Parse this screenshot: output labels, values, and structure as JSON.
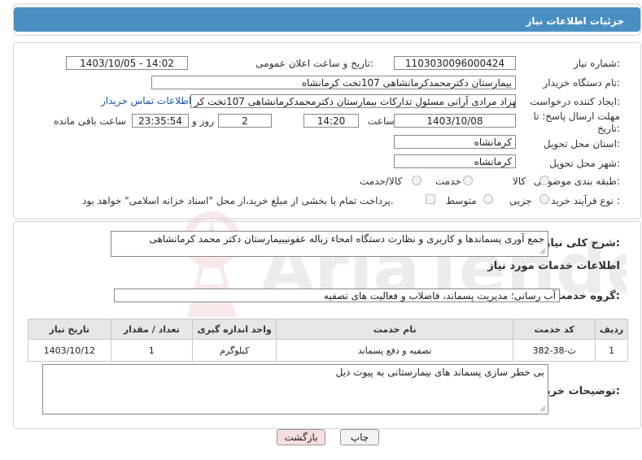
{
  "header": {
    "title": "جزئیات اطلاعات نیاز"
  },
  "form": {
    "need_number_label": "شماره نیاز:",
    "need_number": "1103030096000424",
    "announce_label": "تاریخ و ساعت اعلان عمومی:",
    "announce_value": "1403/10/05 - 14:02",
    "buyer_org_label": "نام دستگاه خریدار:",
    "buyer_org": "بیمارستان دکترمحمدکرمانشاهی 107تخت کرمانشاه",
    "requester_label": "ایجاد کننده درخواست:",
    "requester": "بهزاد مرادی آرانی مسئول تدارکات بیمارستان دکترمحمدکرمانشاهی 107تخت کر",
    "contact_link": "اطلاعات تماس خریدار",
    "deadline_label_1": "مهلت ارسال پاسخ: تا",
    "deadline_label_2": "تاریخ:",
    "deadline_date": "1403/10/08",
    "time_label": "ساعت",
    "deadline_time": "14:20",
    "days_value": "2",
    "days_label": "روز و",
    "remaining_time": "23:35:54",
    "remaining_label": "ساعت باقی مانده",
    "province_label": "استان محل تحویل:",
    "province": "کرمانشاه",
    "city_label": "شهر محل تحویل:",
    "city": "کرمانشاه",
    "category_label": "طبقه بندی موضوعی:",
    "category_options": [
      "کالا",
      "خدمت",
      "کالا/خدمت"
    ],
    "process_label": "نوع فرآیند خرید :",
    "process_options": [
      "جزیی",
      "متوسط"
    ],
    "payment_note": "پرداخت تمام یا بخشی از مبلغ خرید،از محل \"اسناد خزانه اسلامی\" خواهد بود."
  },
  "details": {
    "summary_label": "شرح کلی نیاز:",
    "summary": "جمع آوری پسماندها و کاربری و نظارت دستگاه امحاء زباله عفونیبیمارستان دکتر محمد کرمانشاهی",
    "services_title": "اطلاعات خدمات مورد نیاز",
    "group_label": "گروه خدمت:",
    "group_value": "آب رسانی؛ مدیریت پسماند، فاضلاب و فعالیت های تصفیه",
    "table": {
      "headers": [
        "ردیف",
        "کد خدمت",
        "نام خدمت",
        "واحد اندازه گیری",
        "تعداد / مقدار",
        "تاریخ نیاز"
      ],
      "row": [
        "1",
        "ث-38-382",
        "تصفیه و دفع پسماند",
        "کیلوگرم",
        "1",
        "1403/10/12"
      ]
    },
    "buyer_notes_label": "توضیحات خریدار:",
    "buyer_notes": "بی خطر سازی پسماند های بیمارستانی به پیوت ذیل"
  },
  "buttons": {
    "print": "چاپ",
    "back": "بازگشت"
  },
  "colors": {
    "header_bar": "#4a8fc2",
    "back_button_bg": "#f7dede",
    "print_button_bg": "#f3f3f3"
  }
}
